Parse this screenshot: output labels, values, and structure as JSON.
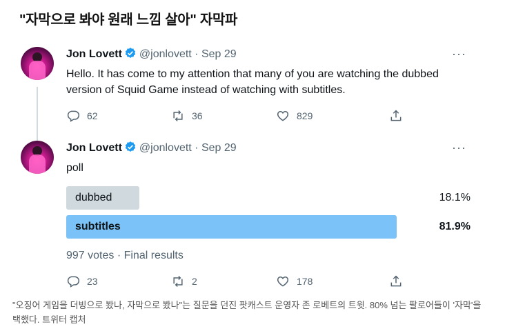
{
  "headline": "\"자막으로 봐야 원래 느낌 살아\" 자막파",
  "tweets": [
    {
      "name": "Jon Lovett",
      "handle_date": "@jonlovett · Sep 29",
      "text": "Hello. It has come to my attention that many of you are watching the dubbed version of Squid Game instead of watching with subtitles.",
      "replies": "62",
      "retweets": "36",
      "likes": "829"
    },
    {
      "name": "Jon Lovett",
      "handle_date": "@jonlovett · Sep 29",
      "text": "poll",
      "replies": "23",
      "retweets": "2",
      "likes": "178",
      "poll": {
        "options": [
          {
            "label": "dubbed",
            "percent_text": "18.1%",
            "fraction": 0.181,
            "winner": false,
            "color": "#cfd9de"
          },
          {
            "label": "subtitles",
            "percent_text": "81.9%",
            "fraction": 0.819,
            "winner": true,
            "color": "#7ac2f7"
          }
        ],
        "result": "997 votes · Final results"
      }
    }
  ],
  "more_glyph": "···",
  "caption": "\"오징어 게임을 더빙으로 봤나, 자막으로 봤나\"는 질문을 던진 팟캐스트 운영자 존 로베트의 트윗. 80% 넘는 팔로어들이 '자막'을 택했다. 트위터 캡처",
  "colors": {
    "verified": "#1d9bf0",
    "muted": "#536471"
  }
}
